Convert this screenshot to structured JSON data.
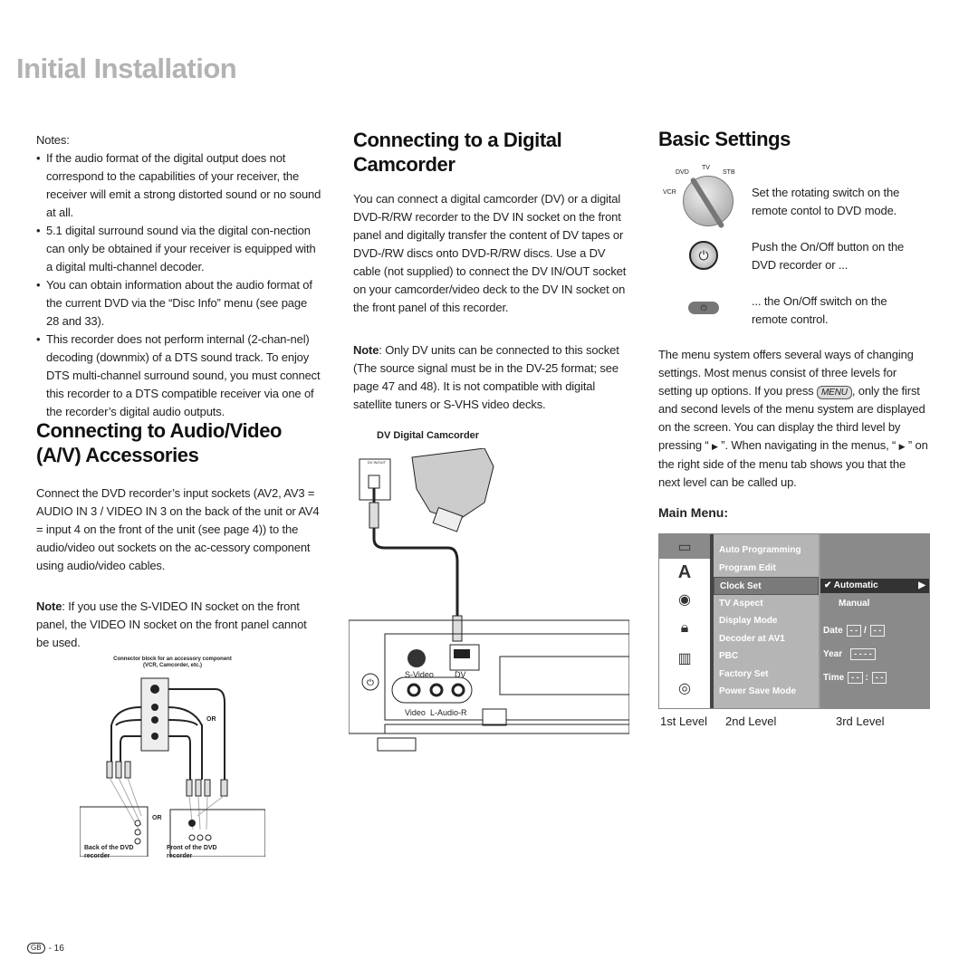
{
  "page_title": "Initial Installation",
  "col1": {
    "notes_label": "Notes",
    "notes": [
      "If the audio format of the digital output does not correspond to the capabilities of your receiver, the receiver will emit a strong distorted sound or no sound at all.",
      "5.1 digital surround sound via the digital con-nection can only be obtained if your receiver is equipped with a digital multi-channel decoder.",
      "You can obtain information about the audio format of the current DVD via the “Disc Info” menu (see page 28 and 33).",
      "This recorder does not perform internal (2-chan-nel) decoding (downmix) of a DTS sound track. To enjoy DTS multi-channel surround sound, you must connect this recorder to a DTS compatible receiver via one of the recorder’s digital audio outputs."
    ],
    "heading": "Connecting to Audio/Video (A/V) Accessories",
    "para": "Connect the DVD recorder’s input sockets (AV2, AV3 = AUDIO IN 3 / VIDEO IN 3 on the back of the unit or AV4 = input 4 on the front of the unit (see page 4)) to the audio/video out sockets on the ac-cessory component using audio/video cables.",
    "note_label": "Note",
    "note": ": If you use the S-VIDEO IN socket on the front panel, the VIDEO IN socket on the front panel cannot be used.",
    "diagram": {
      "title": "Connector block for an accessory component",
      "subtitle": "(VCR, Camcorder, etc.)",
      "or1": "OR",
      "or2": "OR",
      "back": "Back of the DVD recorder",
      "front": "Front of the DVD recorder"
    }
  },
  "col2": {
    "heading": "Connecting to a Digital Camcorder",
    "para": "You can connect a digital camcorder (DV) or a digital DVD-R/RW recorder to the DV IN socket on the front panel and digitally transfer the content of DV tapes or DVD-/RW discs onto DVD-R/RW discs. Use a DV cable (not supplied) to connect the DV IN/OUT socket on your camcorder/video deck to the DV IN socket on the front panel of this recorder.",
    "note_label": "Note",
    "note": ": Only DV units can be connected to this socket (The source signal must be in the DV-25 format; see page 47 and 48). It is not compatible with digital satellite tuners or S-VHS video decks.",
    "diagram": {
      "title": "DV Digital Camcorder",
      "dv_inout": "DV IN/OUT",
      "svideo": "S-Video",
      "dv": "DV",
      "video": "Video",
      "audio": "L-Audio-R"
    }
  },
  "col3": {
    "heading": "Basic Settings",
    "switch_labels": {
      "dvd": "DVD",
      "tv": "TV",
      "stb": "STB",
      "vcr": "VCR"
    },
    "step1": "Set the rotating switch on the remote contol to DVD mode.",
    "step2": "Push the On/Off button on the DVD recorder or ...",
    "step3": "... the On/Off switch on the remote control.",
    "para_a": "The menu system offers several ways of changing settings. Most menus consist of three levels for setting up options. If you press ",
    "menu_key": "MENU",
    "para_b": ", only the first and second levels of the menu system are displayed on the screen. You can display the third level by pressing “ ",
    "para_c": " ”. When navigating in the menus, “ ",
    "para_d": " ” on the right side of the menu tab shows you that the next level can be called up.",
    "main_menu_label": "Main Menu:",
    "menu": {
      "level1_icons": [
        "tv-icon",
        "language-icon",
        "audio-icon",
        "lock-icon",
        "film-icon",
        "disc-icon"
      ],
      "level2": [
        "Auto Programming",
        "Program Edit",
        "Clock Set",
        "TV Aspect",
        "Display Mode",
        "Decoder at AV1",
        "PBC",
        "Factory Set",
        "Power Save Mode"
      ],
      "level2_selected": "Clock Set",
      "automatic": "Automatic",
      "manual": "Manual",
      "date": "Date",
      "date_d": "- -",
      "date_sep": "/",
      "date_m": "- -",
      "year": "Year",
      "year_v": "- - - -",
      "time": "Time",
      "time_h": "- -",
      "time_sep": ":",
      "time_m": "- -"
    },
    "levels": [
      "1st Level",
      "2nd Level",
      "3rd Level"
    ]
  },
  "footer": {
    "badge": "GB",
    "page": "- 16"
  }
}
